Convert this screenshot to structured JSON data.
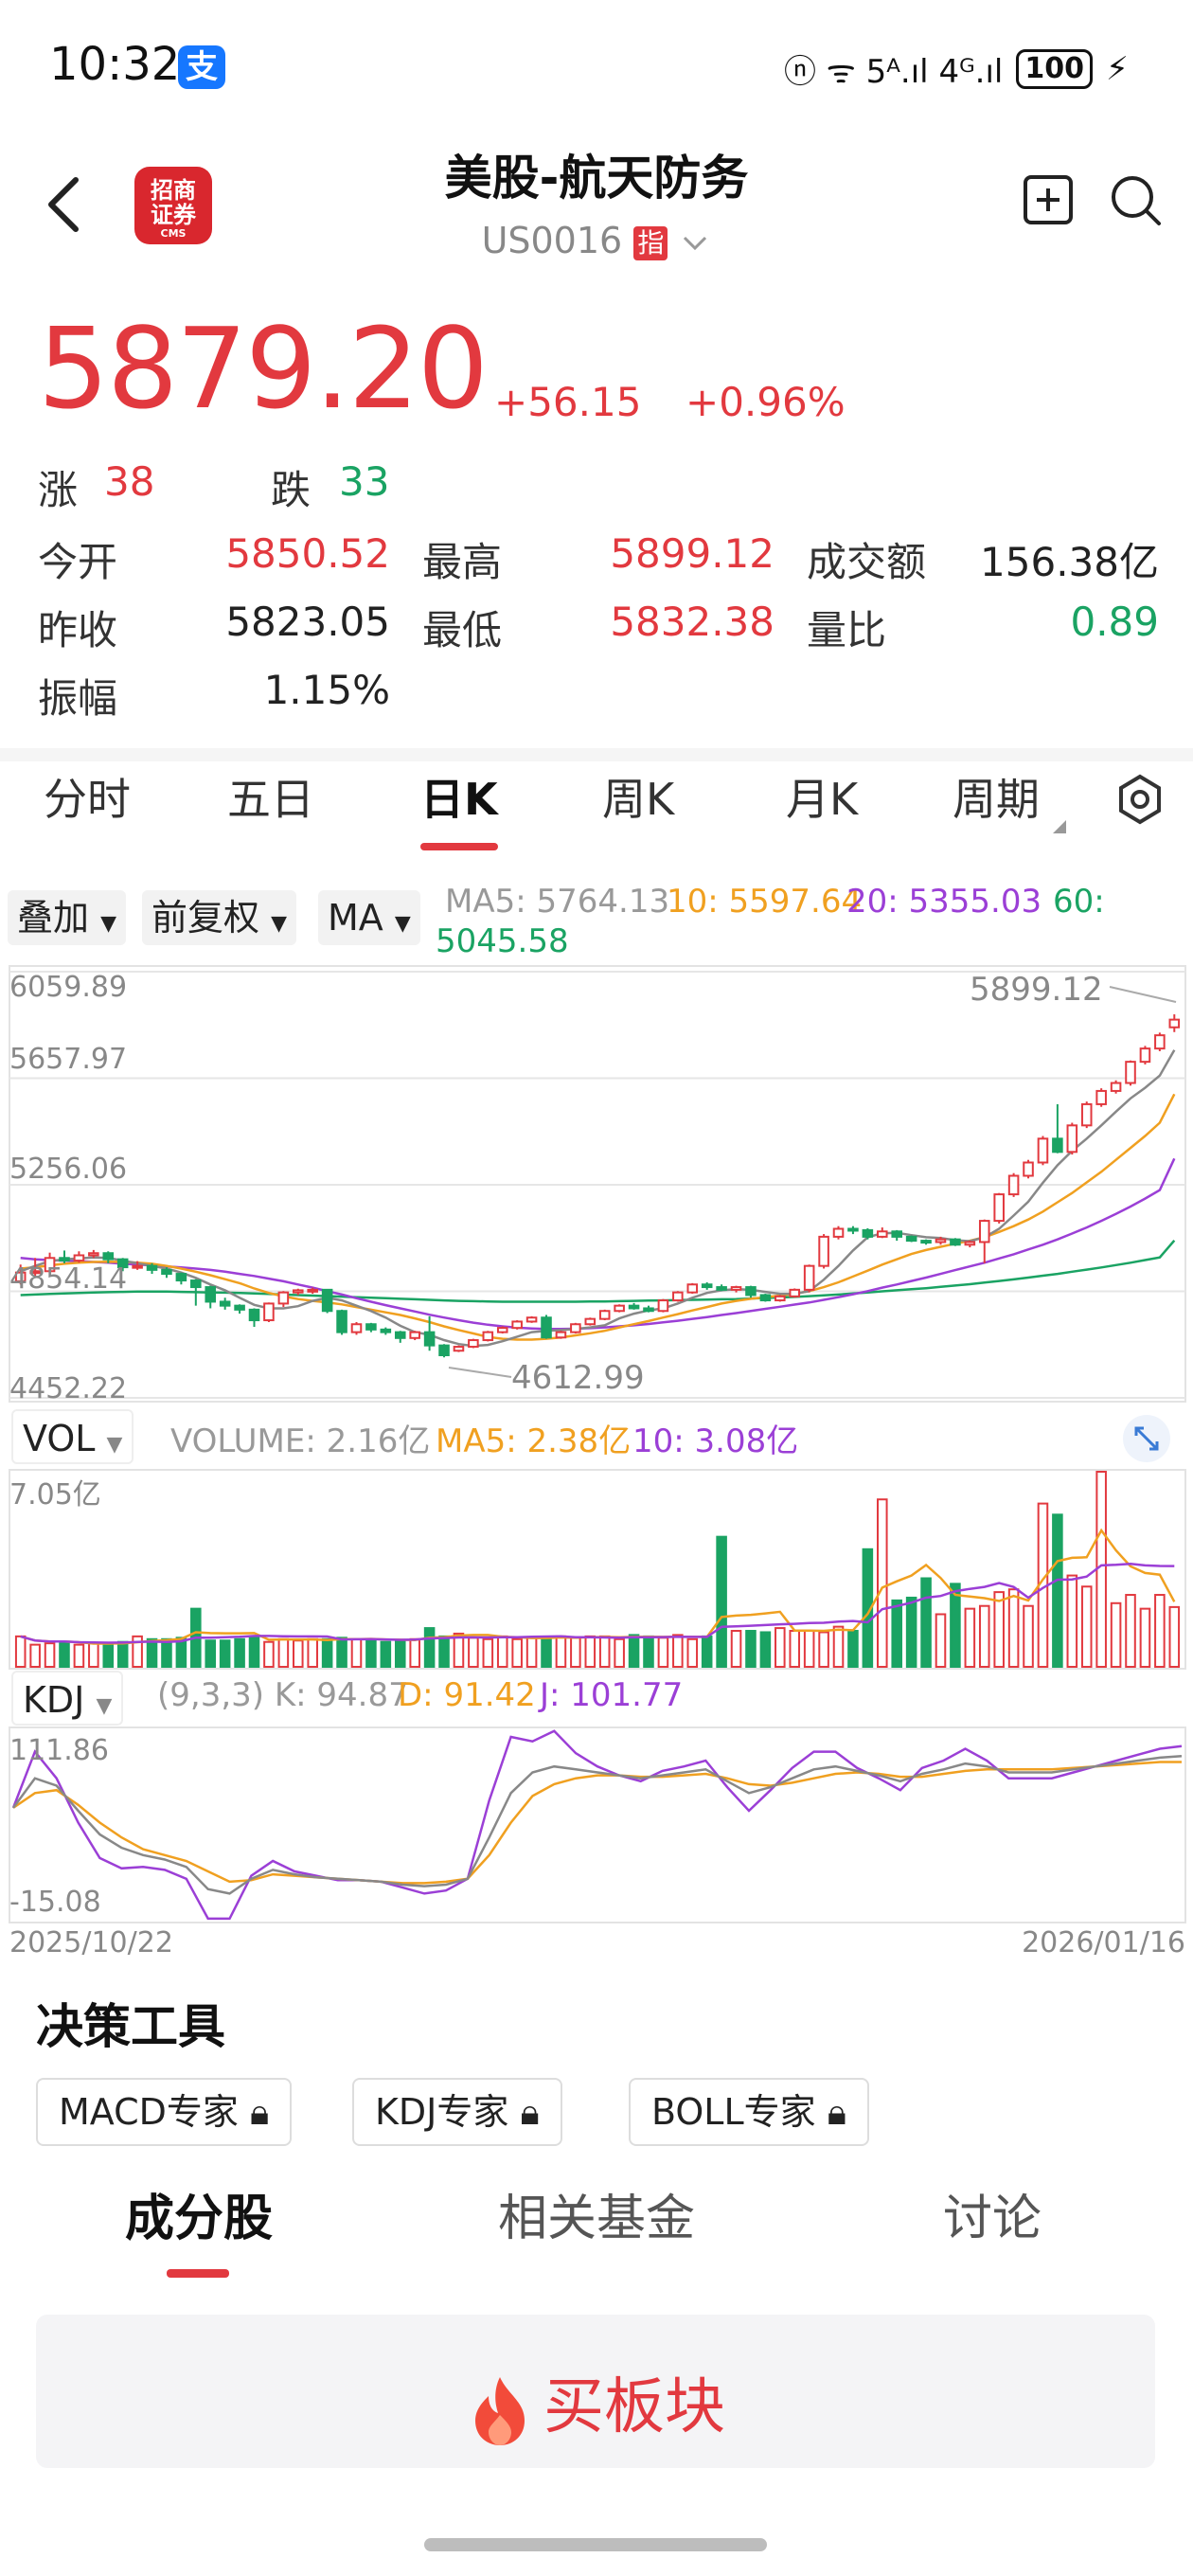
{
  "status": {
    "time": "10:32",
    "alipay_glyph": "支",
    "network": "ⓝ ᯤ 5ᴬ.ıl 4ᴳ.ıl",
    "battery": "100",
    "charging_icon": "bolt-icon"
  },
  "header": {
    "title": "美股-航天防务",
    "code": "US0016",
    "index_badge": "指",
    "logo_lines": [
      "招商",
      "证券",
      "CMS"
    ]
  },
  "quote": {
    "price": "5879.20",
    "change": "+56.15",
    "change_pct": "+0.96%",
    "up_label": "涨",
    "up_count": "38",
    "down_label": "跌",
    "down_count": "33",
    "open_label": "今开",
    "open": "5850.52",
    "high_label": "最高",
    "high": "5899.12",
    "turnover_label": "成交额",
    "turnover": "156.38亿",
    "prev_close_label": "昨收",
    "prev_close": "5823.05",
    "low_label": "最低",
    "low": "5832.38",
    "vol_ratio_label": "量比",
    "vol_ratio": "0.89",
    "amplitude_label": "振幅",
    "amplitude": "1.15%"
  },
  "period_tabs": [
    "分时",
    "五日",
    "日K",
    "周K",
    "月K",
    "周期"
  ],
  "active_period": "日K",
  "toolbar": {
    "overlay": "叠加",
    "adjust": "前复权",
    "indicator": "MA",
    "ma5": "MA5: 5764.13",
    "ma10": "10: 5597.64",
    "ma20": "20: 5355.03",
    "ma60_label": "60:",
    "ma60_value": "5045.58"
  },
  "price_axis": [
    "6059.89",
    "5657.97",
    "5256.06",
    "4854.14",
    "4452.22"
  ],
  "price_annotations": {
    "high": "5899.12",
    "low": "4612.99"
  },
  "volume": {
    "selector": "VOL",
    "volume": "VOLUME: 2.16亿",
    "ma5": "MA5: 2.38亿",
    "ma10": "10: 3.08亿",
    "axis_max": "7.05亿"
  },
  "kdj": {
    "selector": "KDJ",
    "params": "(9,3,3) K: 94.87",
    "d": "D: 91.42",
    "j": "J: 101.77",
    "axis_max": "111.86",
    "axis_min": "-15.08"
  },
  "dates": {
    "start": "2025/10/22",
    "end": "2026/01/16"
  },
  "colors": {
    "up": "#e2393f",
    "down": "#1aa363",
    "ma5": "#888888",
    "ma10": "#f0a020",
    "ma20": "#9b3fd6",
    "ma60": "#1aa363"
  },
  "chart_data": {
    "type": "candlestick",
    "dates": [
      "2025/10/22",
      "2026/01/16"
    ],
    "ylim": [
      4452.22,
      6059.89
    ],
    "candles": [
      [
        4892,
        4925,
        4955,
        4880
      ],
      [
        4925,
        4930,
        4980,
        4908
      ],
      [
        4930,
        4980,
        5000,
        4920
      ],
      [
        4980,
        4970,
        5008,
        4960
      ],
      [
        4970,
        4990,
        5005,
        4962
      ],
      [
        4990,
        4998,
        5010,
        4980
      ],
      [
        4998,
        4975,
        5005,
        4960
      ],
      [
        4975,
        4945,
        4980,
        4930
      ],
      [
        4945,
        4950,
        4968,
        4935
      ],
      [
        4950,
        4935,
        4960,
        4920
      ],
      [
        4935,
        4920,
        4945,
        4905
      ],
      [
        4920,
        4895,
        4925,
        4880
      ],
      [
        4895,
        4870,
        4900,
        4800
      ],
      [
        4870,
        4815,
        4875,
        4790
      ],
      [
        4815,
        4800,
        4830,
        4785
      ],
      [
        4800,
        4785,
        4805,
        4770
      ],
      [
        4785,
        4745,
        4790,
        4720
      ],
      [
        4745,
        4808,
        4812,
        4738
      ],
      [
        4808,
        4850,
        4855,
        4795
      ],
      [
        4850,
        4858,
        4864,
        4840
      ],
      [
        4858,
        4860,
        4868,
        4845
      ],
      [
        4860,
        4780,
        4862,
        4772
      ],
      [
        4780,
        4700,
        4785,
        4690
      ],
      [
        4700,
        4730,
        4738,
        4690
      ],
      [
        4730,
        4710,
        4735,
        4700
      ],
      [
        4710,
        4700,
        4718,
        4690
      ],
      [
        4700,
        4678,
        4705,
        4660
      ],
      [
        4678,
        4700,
        4705,
        4670
      ],
      [
        4700,
        4650,
        4760,
        4630
      ],
      [
        4650,
        4613,
        4655,
        4605
      ],
      [
        4630,
        4645,
        4650,
        4625
      ],
      [
        4645,
        4670,
        4675,
        4640
      ],
      [
        4670,
        4700,
        4705,
        4665
      ],
      [
        4700,
        4716,
        4722,
        4695
      ],
      [
        4716,
        4740,
        4745,
        4710
      ],
      [
        4740,
        4755,
        4760,
        4735
      ],
      [
        4755,
        4680,
        4765,
        4675
      ],
      [
        4680,
        4700,
        4705,
        4675
      ],
      [
        4700,
        4730,
        4735,
        4695
      ],
      [
        4730,
        4750,
        4755,
        4725
      ],
      [
        4750,
        4780,
        4785,
        4745
      ],
      [
        4780,
        4800,
        4805,
        4775
      ],
      [
        4800,
        4790,
        4810,
        4785
      ],
      [
        4790,
        4780,
        4800,
        4775
      ],
      [
        4780,
        4820,
        4825,
        4775
      ],
      [
        4820,
        4850,
        4855,
        4815
      ],
      [
        4850,
        4880,
        4885,
        4845
      ],
      [
        4880,
        4870,
        4888,
        4860
      ],
      [
        4870,
        4860,
        4880,
        4855
      ],
      [
        4860,
        4870,
        4875,
        4850
      ],
      [
        4870,
        4840,
        4875,
        4830
      ],
      [
        4840,
        4820,
        4845,
        4815
      ],
      [
        4820,
        4835,
        4840,
        4815
      ],
      [
        4835,
        4860,
        4865,
        4830
      ],
      [
        4860,
        4950,
        4955,
        4850
      ],
      [
        4950,
        5060,
        5070,
        4940
      ],
      [
        5060,
        5090,
        5100,
        5050
      ],
      [
        5090,
        5085,
        5100,
        5070
      ],
      [
        5085,
        5060,
        5092,
        5050
      ],
      [
        5060,
        5080,
        5095,
        5055
      ],
      [
        5080,
        5060,
        5085,
        5045
      ],
      [
        5060,
        5045,
        5065,
        5040
      ],
      [
        5045,
        5040,
        5050,
        5030
      ],
      [
        5040,
        5050,
        5060,
        5030
      ],
      [
        5050,
        5030,
        5055,
        5025
      ],
      [
        5030,
        5040,
        5045,
        5020
      ],
      [
        5040,
        5120,
        5125,
        4960
      ],
      [
        5120,
        5220,
        5225,
        5110
      ],
      [
        5220,
        5290,
        5300,
        5210
      ],
      [
        5290,
        5340,
        5350,
        5280
      ],
      [
        5340,
        5430,
        5440,
        5330
      ],
      [
        5430,
        5380,
        5560,
        5375
      ],
      [
        5380,
        5480,
        5490,
        5370
      ],
      [
        5480,
        5560,
        5570,
        5470
      ],
      [
        5560,
        5610,
        5620,
        5550
      ],
      [
        5610,
        5640,
        5650,
        5600
      ],
      [
        5640,
        5720,
        5725,
        5630
      ],
      [
        5720,
        5770,
        5780,
        5710
      ],
      [
        5770,
        5820,
        5830,
        5760
      ],
      [
        5850,
        5879,
        5899,
        5832
      ]
    ],
    "ma5": [
      4930,
      4950,
      4968,
      4975,
      4978,
      4982,
      4980,
      4970,
      4960,
      4950,
      4940,
      4925,
      4905,
      4880,
      4858,
      4830,
      4803,
      4790,
      4790,
      4798,
      4818,
      4830,
      4820,
      4800,
      4780,
      4755,
      4724,
      4700,
      4690,
      4670,
      4655,
      4648,
      4652,
      4666,
      4683,
      4700,
      4705,
      4708,
      4712,
      4718,
      4726,
      4752,
      4770,
      4782,
      4790,
      4808,
      4830,
      4848,
      4858,
      4862,
      4860,
      4852,
      4845,
      4845,
      4855,
      4898,
      4950,
      5008,
      5058,
      5073,
      5075,
      5066,
      5058,
      5055,
      5047,
      5043,
      5058,
      5090,
      5140,
      5192,
      5264,
      5330,
      5384,
      5430,
      5480,
      5532,
      5582,
      5622,
      5668,
      5764
    ],
    "ma10": [
      4940,
      4945,
      4952,
      4958,
      4962,
      4965,
      4966,
      4965,
      4962,
      4958,
      4950,
      4940,
      4928,
      4915,
      4900,
      4885,
      4865,
      4848,
      4835,
      4825,
      4818,
      4812,
      4805,
      4795,
      4785,
      4775,
      4765,
      4752,
      4738,
      4722,
      4708,
      4695,
      4682,
      4675,
      4672,
      4672,
      4675,
      4680,
      4688,
      4696,
      4705,
      4718,
      4730,
      4742,
      4755,
      4768,
      4782,
      4795,
      4808,
      4818,
      4826,
      4832,
      4838,
      4845,
      4855,
      4870,
      4888,
      4910,
      4932,
      4955,
      4975,
      4995,
      5010,
      5022,
      5034,
      5045,
      5058,
      5078,
      5100,
      5125,
      5155,
      5190,
      5225,
      5265,
      5305,
      5350,
      5395,
      5440,
      5490,
      5598
    ],
    "ma20": [
      4980,
      4975,
      4972,
      4970,
      4968,
      4965,
      4962,
      4958,
      4955,
      4952,
      4948,
      4944,
      4940,
      4935,
      4928,
      4920,
      4912,
      4902,
      4892,
      4880,
      4868,
      4855,
      4842,
      4828,
      4815,
      4802,
      4790,
      4778,
      4766,
      4755,
      4745,
      4736,
      4728,
      4722,
      4717,
      4714,
      4712,
      4712,
      4713,
      4715,
      4718,
      4722,
      4726,
      4731,
      4737,
      4743,
      4750,
      4757,
      4765,
      4772,
      4780,
      4788,
      4796,
      4804,
      4812,
      4822,
      4832,
      4843,
      4855,
      4868,
      4880,
      4893,
      4906,
      4920,
      4934,
      4948,
      4962,
      4978,
      4994,
      5012,
      5030,
      5050,
      5072,
      5095,
      5120,
      5146,
      5174,
      5204,
      5236,
      5355
    ],
    "ma60": [
      4840,
      4842,
      4844,
      4846,
      4848,
      4850,
      4851,
      4852,
      4853,
      4853,
      4853,
      4852,
      4851,
      4850,
      4849,
      4848,
      4846,
      4844,
      4842,
      4840,
      4838,
      4836,
      4834,
      4832,
      4830,
      4828,
      4826,
      4824,
      4822,
      4820,
      4818,
      4817,
      4816,
      4815,
      4815,
      4815,
      4815,
      4815,
      4815,
      4816,
      4816,
      4817,
      4818,
      4819,
      4820,
      4821,
      4822,
      4823,
      4824,
      4825,
      4827,
      4829,
      4831,
      4833,
      4836,
      4839,
      4842,
      4846,
      4850,
      4854,
      4858,
      4862,
      4866,
      4871,
      4876,
      4881,
      4887,
      4893,
      4899,
      4906,
      4913,
      4920,
      4928,
      4936,
      4944,
      4953,
      4962,
      4972,
      4982,
      5046
    ],
    "volume_yi": [
      1.1,
      0.8,
      0.85,
      0.9,
      0.8,
      0.85,
      0.8,
      0.9,
      1.1,
      1.0,
      1.0,
      1.05,
      2.1,
      0.95,
      0.95,
      1.0,
      1.1,
      0.9,
      1.0,
      0.95,
      1.0,
      1.0,
      1.05,
      1.0,
      1.0,
      0.9,
      0.95,
      1.0,
      1.4,
      1.1,
      1.2,
      1.05,
      1.0,
      1.1,
      1.0,
      1.05,
      1.05,
      1.1,
      1.05,
      1.1,
      1.1,
      1.0,
      1.15,
      1.1,
      1.05,
      1.15,
      1.0,
      1.1,
      4.7,
      1.3,
      1.3,
      1.25,
      1.4,
      1.3,
      1.3,
      1.25,
      1.45,
      1.3,
      4.25,
      6.05,
      2.4,
      2.5,
      3.2,
      1.9,
      3.0,
      2.1,
      2.2,
      2.7,
      2.8,
      2.2,
      5.9,
      5.5,
      3.3,
      2.9,
      7.05,
      2.3,
      2.6,
      2.1,
      2.6,
      2.16
    ],
    "kdj_k": [
      60,
      80,
      75,
      58,
      42,
      33,
      28,
      25,
      20,
      5,
      2,
      12,
      18,
      15,
      13,
      12,
      11,
      10,
      8,
      7,
      8,
      12,
      40,
      70,
      84,
      88,
      86,
      84,
      82,
      80,
      82,
      84,
      86,
      78,
      70,
      74,
      80,
      86,
      88,
      85,
      82,
      78,
      83,
      86,
      90,
      88,
      84,
      84,
      84,
      86,
      88,
      90,
      92,
      94,
      95
    ],
    "kdj_d": [
      60,
      70,
      72,
      62,
      50,
      40,
      32,
      28,
      24,
      17,
      10,
      11,
      15,
      14,
      13,
      12,
      11,
      10,
      9,
      9,
      10,
      12,
      28,
      50,
      68,
      76,
      80,
      82,
      82,
      81,
      81,
      82,
      83,
      80,
      76,
      75,
      77,
      80,
      83,
      84,
      83,
      81,
      81,
      83,
      85,
      86,
      86,
      86,
      86,
      87,
      88,
      89,
      90,
      91,
      91
    ],
    "kdj_j": [
      60,
      98,
      80,
      50,
      26,
      19,
      20,
      18,
      12,
      -15,
      -15,
      14,
      24,
      17,
      14,
      11,
      11,
      10,
      6,
      2,
      4,
      12,
      65,
      108,
      105,
      112,
      97,
      88,
      82,
      78,
      85,
      88,
      92,
      74,
      58,
      72,
      87,
      98,
      98,
      87,
      80,
      72,
      87,
      92,
      100,
      92,
      80,
      80,
      80,
      84,
      88,
      92,
      96,
      100,
      101.77
    ]
  },
  "tools": {
    "title": "决策工具",
    "items": [
      "MACD专家",
      "KDJ专家",
      "BOLL专家"
    ]
  },
  "bottom_tabs": [
    "成分股",
    "相关基金",
    "讨论"
  ],
  "active_bottom_tab": "成分股",
  "buy": {
    "label": "买板块"
  }
}
